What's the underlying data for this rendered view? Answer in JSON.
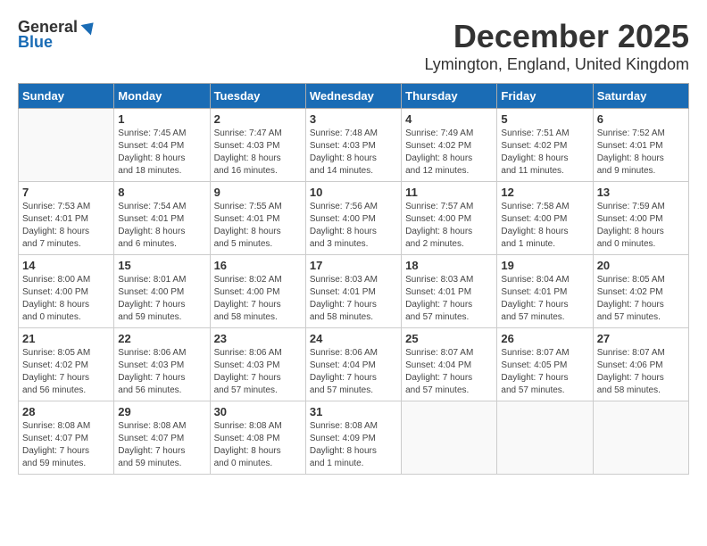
{
  "logo": {
    "general": "General",
    "blue": "Blue"
  },
  "title": "December 2025",
  "location": "Lymington, England, United Kingdom",
  "days_of_week": [
    "Sunday",
    "Monday",
    "Tuesday",
    "Wednesday",
    "Thursday",
    "Friday",
    "Saturday"
  ],
  "weeks": [
    [
      {
        "day": "",
        "info": ""
      },
      {
        "day": "1",
        "info": "Sunrise: 7:45 AM\nSunset: 4:04 PM\nDaylight: 8 hours\nand 18 minutes."
      },
      {
        "day": "2",
        "info": "Sunrise: 7:47 AM\nSunset: 4:03 PM\nDaylight: 8 hours\nand 16 minutes."
      },
      {
        "day": "3",
        "info": "Sunrise: 7:48 AM\nSunset: 4:03 PM\nDaylight: 8 hours\nand 14 minutes."
      },
      {
        "day": "4",
        "info": "Sunrise: 7:49 AM\nSunset: 4:02 PM\nDaylight: 8 hours\nand 12 minutes."
      },
      {
        "day": "5",
        "info": "Sunrise: 7:51 AM\nSunset: 4:02 PM\nDaylight: 8 hours\nand 11 minutes."
      },
      {
        "day": "6",
        "info": "Sunrise: 7:52 AM\nSunset: 4:01 PM\nDaylight: 8 hours\nand 9 minutes."
      }
    ],
    [
      {
        "day": "7",
        "info": "Sunrise: 7:53 AM\nSunset: 4:01 PM\nDaylight: 8 hours\nand 7 minutes."
      },
      {
        "day": "8",
        "info": "Sunrise: 7:54 AM\nSunset: 4:01 PM\nDaylight: 8 hours\nand 6 minutes."
      },
      {
        "day": "9",
        "info": "Sunrise: 7:55 AM\nSunset: 4:01 PM\nDaylight: 8 hours\nand 5 minutes."
      },
      {
        "day": "10",
        "info": "Sunrise: 7:56 AM\nSunset: 4:00 PM\nDaylight: 8 hours\nand 3 minutes."
      },
      {
        "day": "11",
        "info": "Sunrise: 7:57 AM\nSunset: 4:00 PM\nDaylight: 8 hours\nand 2 minutes."
      },
      {
        "day": "12",
        "info": "Sunrise: 7:58 AM\nSunset: 4:00 PM\nDaylight: 8 hours\nand 1 minute."
      },
      {
        "day": "13",
        "info": "Sunrise: 7:59 AM\nSunset: 4:00 PM\nDaylight: 8 hours\nand 0 minutes."
      }
    ],
    [
      {
        "day": "14",
        "info": "Sunrise: 8:00 AM\nSunset: 4:00 PM\nDaylight: 8 hours\nand 0 minutes."
      },
      {
        "day": "15",
        "info": "Sunrise: 8:01 AM\nSunset: 4:00 PM\nDaylight: 7 hours\nand 59 minutes."
      },
      {
        "day": "16",
        "info": "Sunrise: 8:02 AM\nSunset: 4:00 PM\nDaylight: 7 hours\nand 58 minutes."
      },
      {
        "day": "17",
        "info": "Sunrise: 8:03 AM\nSunset: 4:01 PM\nDaylight: 7 hours\nand 58 minutes."
      },
      {
        "day": "18",
        "info": "Sunrise: 8:03 AM\nSunset: 4:01 PM\nDaylight: 7 hours\nand 57 minutes."
      },
      {
        "day": "19",
        "info": "Sunrise: 8:04 AM\nSunset: 4:01 PM\nDaylight: 7 hours\nand 57 minutes."
      },
      {
        "day": "20",
        "info": "Sunrise: 8:05 AM\nSunset: 4:02 PM\nDaylight: 7 hours\nand 57 minutes."
      }
    ],
    [
      {
        "day": "21",
        "info": "Sunrise: 8:05 AM\nSunset: 4:02 PM\nDaylight: 7 hours\nand 56 minutes."
      },
      {
        "day": "22",
        "info": "Sunrise: 8:06 AM\nSunset: 4:03 PM\nDaylight: 7 hours\nand 56 minutes."
      },
      {
        "day": "23",
        "info": "Sunrise: 8:06 AM\nSunset: 4:03 PM\nDaylight: 7 hours\nand 57 minutes."
      },
      {
        "day": "24",
        "info": "Sunrise: 8:06 AM\nSunset: 4:04 PM\nDaylight: 7 hours\nand 57 minutes."
      },
      {
        "day": "25",
        "info": "Sunrise: 8:07 AM\nSunset: 4:04 PM\nDaylight: 7 hours\nand 57 minutes."
      },
      {
        "day": "26",
        "info": "Sunrise: 8:07 AM\nSunset: 4:05 PM\nDaylight: 7 hours\nand 57 minutes."
      },
      {
        "day": "27",
        "info": "Sunrise: 8:07 AM\nSunset: 4:06 PM\nDaylight: 7 hours\nand 58 minutes."
      }
    ],
    [
      {
        "day": "28",
        "info": "Sunrise: 8:08 AM\nSunset: 4:07 PM\nDaylight: 7 hours\nand 59 minutes."
      },
      {
        "day": "29",
        "info": "Sunrise: 8:08 AM\nSunset: 4:07 PM\nDaylight: 7 hours\nand 59 minutes."
      },
      {
        "day": "30",
        "info": "Sunrise: 8:08 AM\nSunset: 4:08 PM\nDaylight: 8 hours\nand 0 minutes."
      },
      {
        "day": "31",
        "info": "Sunrise: 8:08 AM\nSunset: 4:09 PM\nDaylight: 8 hours\nand 1 minute."
      },
      {
        "day": "",
        "info": ""
      },
      {
        "day": "",
        "info": ""
      },
      {
        "day": "",
        "info": ""
      }
    ]
  ]
}
